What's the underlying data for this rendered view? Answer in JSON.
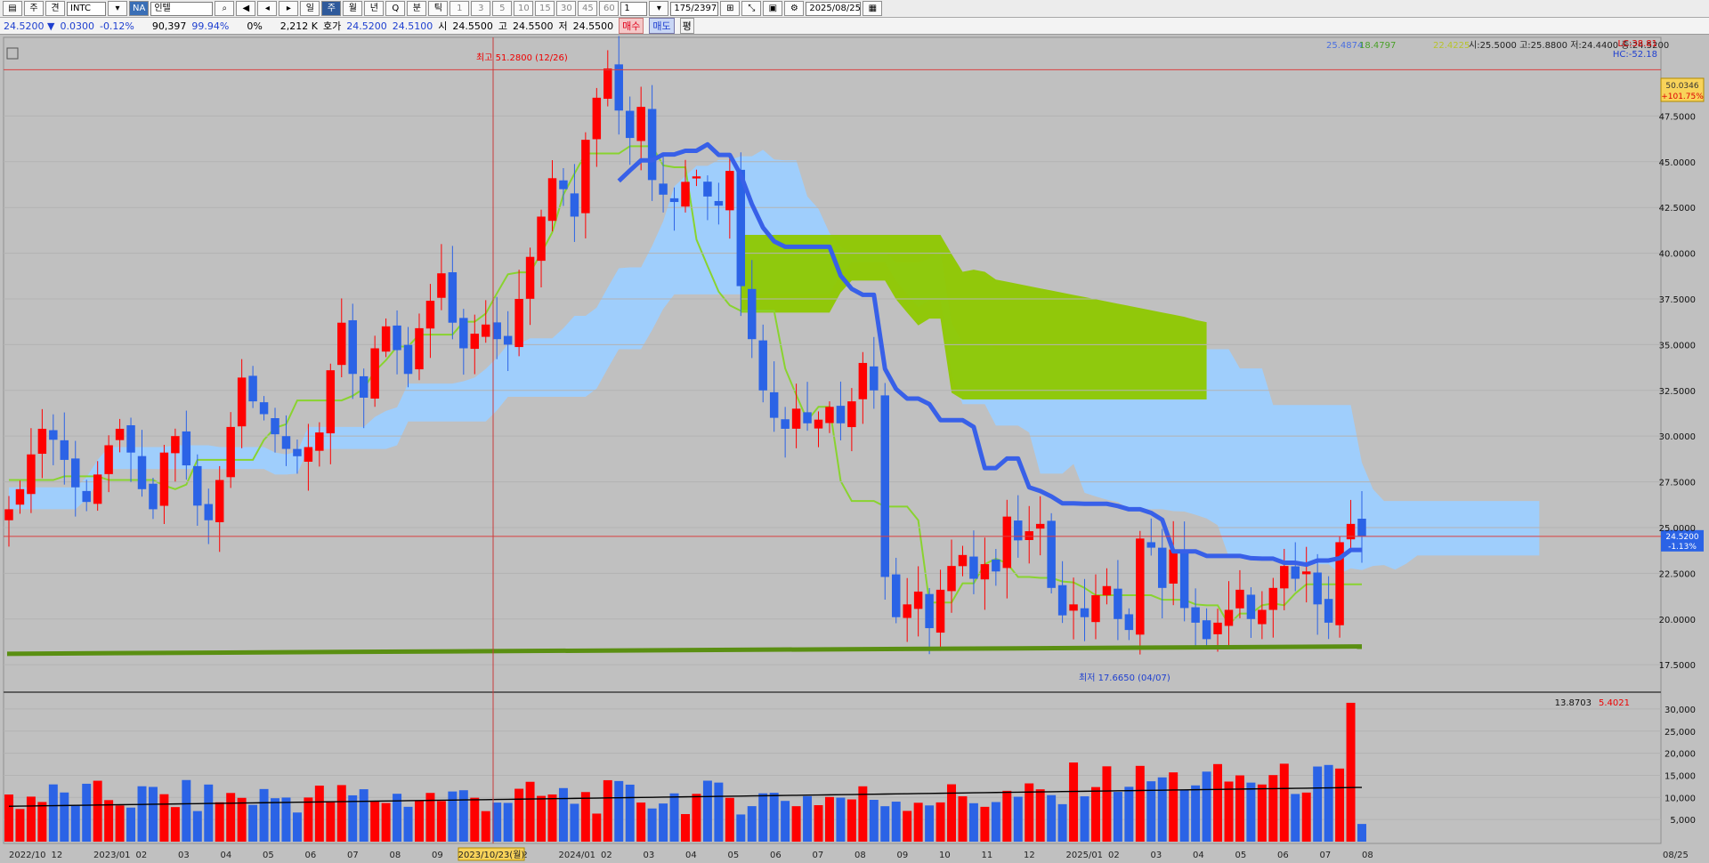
{
  "toolbar": {
    "period_buttons": [
      "주",
      "견"
    ],
    "symbol": "INTC",
    "market_badge": "NA",
    "name": "인텔",
    "timeframes": [
      "일",
      "주",
      "월",
      "년",
      "Q",
      "분",
      "틱"
    ],
    "selected_timeframe": "주",
    "intervals": [
      "1",
      "3",
      "5",
      "10",
      "15",
      "30",
      "45",
      "60"
    ],
    "unit": "1",
    "count": "175/2397",
    "date": "2025/08/25"
  },
  "quote": {
    "price": "24.5200",
    "change": "0.0300",
    "change_pct": "-0.12%",
    "volume": "90,397",
    "vol_ratio": "99.94%",
    "zero_label": "0%",
    "amount": "2,212 K",
    "bidask_label": "호가",
    "ask": "24.5200",
    "bid": "24.5100",
    "open_label": "시",
    "open": "24.5500",
    "high_label": "고",
    "high": "24.5500",
    "low_label": "저",
    "low": "24.5500",
    "buy_label": "매수",
    "sell_label": "매도",
    "flat_label": "평"
  },
  "indicators": {
    "ichimoku_a": "25.4874",
    "ichimoku_b": "18.4797",
    "ichimoku_c": "22.4225",
    "ohlc_text": "시:25.5000 고:25.8800 저:24.4400 종:24.5200",
    "lc": "LC:38.81",
    "hc": "HC:-52.18",
    "top_badge_price": "50.0346",
    "top_badge_pct": "+101.75%",
    "last_price_badge": "24.5200",
    "last_price_pct": "-1.13%",
    "max_label": "최고 51.2800 (12/26)",
    "min_label": "최저 17.6650 (04/07)",
    "crosshair_date": "2023/10/23(월)",
    "volume_header_black": "13.8703",
    "volume_header_red": "5.4021",
    "right_date": "08/25"
  },
  "colors": {
    "up": "#ff0000",
    "down": "#2b63e6",
    "cloud": "#9dcfff",
    "cloud_green": "#8ec800",
    "lagging": "#89d32f",
    "base_line": "#3860e8",
    "support": "#5a8f12",
    "ma_volume": "#000000"
  },
  "chart_data": {
    "type": "candlestick",
    "y_ticks": [
      17.5,
      20,
      22.5,
      25,
      27.5,
      30,
      32.5,
      35,
      37.5,
      40,
      42.5,
      45,
      47.5
    ],
    "y_tick_labels": [
      "17.5000",
      "20.0000",
      "22.5000",
      "25.0000",
      "27.5000",
      "30.0000",
      "32.5000",
      "35.0000",
      "37.5000",
      "40.0000",
      "42.5000",
      "45.0000",
      "47.5000"
    ],
    "ylim": [
      16,
      51.8
    ],
    "x_labels": [
      "2022/10",
      "12",
      "2023/01",
      "02",
      "03",
      "04",
      "05",
      "06",
      "07",
      "08",
      "09",
      "2023/10/23(월)",
      "12",
      "2024/01",
      "02",
      "03",
      "04",
      "05",
      "06",
      "07",
      "08",
      "09",
      "10",
      "11",
      "12",
      "2025/01",
      "02",
      "03",
      "04",
      "05",
      "06",
      "07",
      "08"
    ],
    "weekly_closes": [
      26.0,
      27.1,
      29.0,
      30.4,
      29.8,
      28.7,
      27.2,
      26.4,
      27.9,
      29.5,
      30.4,
      29.1,
      27.1,
      26.0,
      29.1,
      30.0,
      28.4,
      26.2,
      25.4,
      27.6,
      30.5,
      33.2,
      31.9,
      31.2,
      30.1,
      29.3,
      28.9,
      29.4,
      30.2,
      33.6,
      36.2,
      33.4,
      32.1,
      34.8,
      36.0,
      34.7,
      33.4,
      35.9,
      37.4,
      38.9,
      36.2,
      34.8,
      35.6,
      36.1,
      35.3,
      35.0,
      37.5,
      39.8,
      42.0,
      44.1,
      43.5,
      42.0,
      46.2,
      48.5,
      50.1,
      47.8,
      46.3,
      48.0,
      44.0,
      43.2,
      42.8,
      43.9,
      44.2,
      43.1,
      42.6,
      44.5,
      38.2,
      35.3,
      32.5,
      31.0,
      30.4,
      31.5,
      30.7,
      30.9,
      31.6,
      30.7,
      31.9,
      34.0,
      32.5,
      22.3,
      20.1,
      20.8,
      21.5,
      19.5,
      21.6,
      22.9,
      23.5,
      22.2,
      23.0,
      22.6,
      25.6,
      24.3,
      24.8,
      25.2,
      21.7,
      20.2,
      20.8,
      20.1,
      21.3,
      21.8,
      20.0,
      19.4,
      24.4,
      23.9,
      21.7,
      23.8,
      20.6,
      19.8,
      18.9,
      19.8,
      20.5,
      21.6,
      20.0,
      20.5,
      21.7,
      22.9,
      22.2,
      22.6,
      20.8,
      19.8,
      24.2,
      25.2,
      24.52
    ],
    "support_line": {
      "from": 18.1,
      "to": 18.5
    },
    "volume_ticks": [
      5000,
      10000,
      15000,
      20000,
      25000,
      30000
    ],
    "volume_tick_labels": [
      "5,000",
      "10,000",
      "15,000",
      "20,000",
      "25,000",
      "30,000"
    ]
  }
}
